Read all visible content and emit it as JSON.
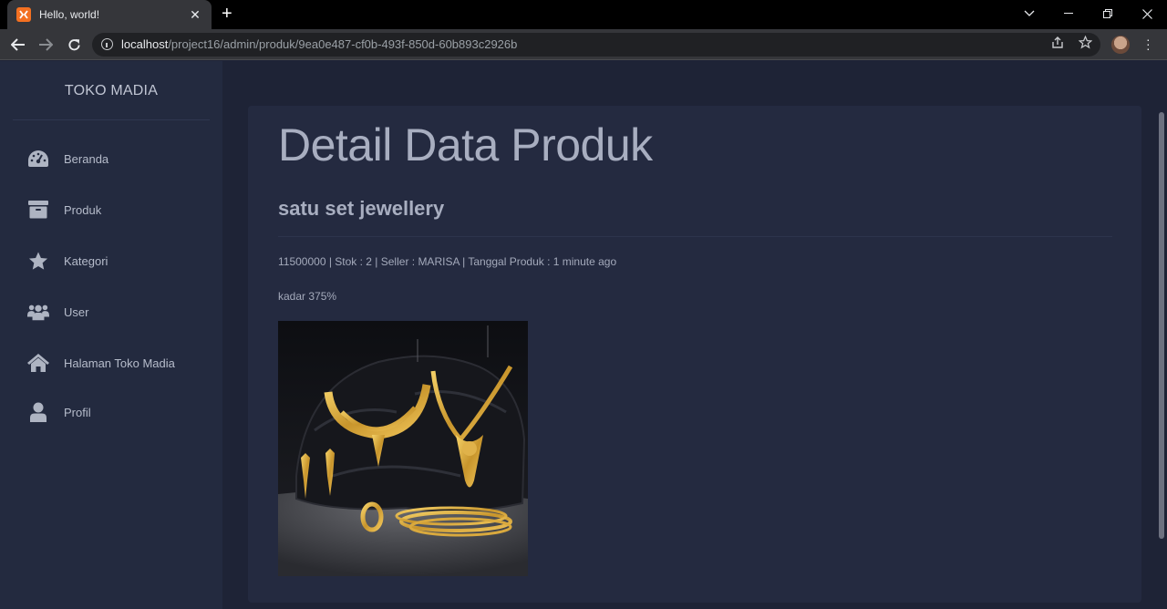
{
  "browser": {
    "tab_title": "Hello, world!",
    "url_host": "localhost",
    "url_path": "/project16/admin/produk/9ea0e487-cf0b-493f-850d-60b893c2926b"
  },
  "sidebar": {
    "brand": "TOKO MADIA",
    "items": [
      {
        "label": "Beranda",
        "icon": "dashboard-icon"
      },
      {
        "label": "Produk",
        "icon": "archive-box-icon"
      },
      {
        "label": "Kategori",
        "icon": "star-icon"
      },
      {
        "label": "User",
        "icon": "users-icon"
      },
      {
        "label": "Halaman Toko Madia",
        "icon": "home-icon"
      },
      {
        "label": "Profil",
        "icon": "user-icon"
      }
    ]
  },
  "main": {
    "title": "Detail Data Produk",
    "product_name": "satu set jewellery",
    "meta_line": "11500000 | Stok : 2 | Seller : MARISA | Tanggal Produk : 1 minute ago",
    "description": "kadar 375%",
    "image_subject": "gold jewellery set on dark rock"
  }
}
